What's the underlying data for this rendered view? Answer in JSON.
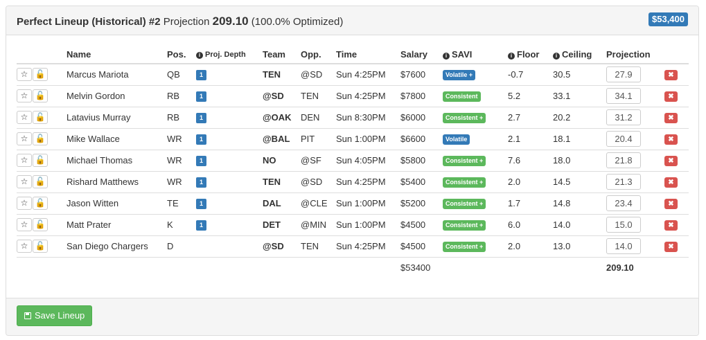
{
  "header": {
    "title_bold": "Perfect Lineup (Historical) #2",
    "projection_label": "Projection",
    "projection_value": "209.10",
    "optimized_text": "(100.0% Optimized)",
    "salary_badge": "$53,400"
  },
  "columns": {
    "name": "Name",
    "pos": "Pos.",
    "depth": "Proj. Depth",
    "team": "Team",
    "opp": "Opp.",
    "time": "Time",
    "salary": "Salary",
    "savi": "SAVI",
    "floor": "Floor",
    "ceiling": "Ceiling",
    "projection": "Projection"
  },
  "colors": {
    "volatile": "#337ab7",
    "consistent": "#5cb85c",
    "remove": "#d9534f",
    "depth": "#337ab7"
  },
  "rows": [
    {
      "name": "Marcus Mariota",
      "pos": "QB",
      "depth": "1",
      "team": "TEN",
      "team_bold": true,
      "opp": "@SD",
      "time": "Sun 4:25PM",
      "salary": "$7600",
      "savi": "Volatile +",
      "savi_type": "volatile",
      "floor": "-0.7",
      "ceiling": "30.5",
      "projection": "27.9"
    },
    {
      "name": "Melvin Gordon",
      "pos": "RB",
      "depth": "1",
      "team": "@SD",
      "team_bold": true,
      "opp": "TEN",
      "time": "Sun 4:25PM",
      "salary": "$7800",
      "savi": "Consistent",
      "savi_type": "consistent",
      "floor": "5.2",
      "ceiling": "33.1",
      "projection": "34.1"
    },
    {
      "name": "Latavius Murray",
      "pos": "RB",
      "depth": "1",
      "team": "@OAK",
      "team_bold": true,
      "opp": "DEN",
      "time": "Sun 8:30PM",
      "salary": "$6000",
      "savi": "Consistent +",
      "savi_type": "consistent",
      "floor": "2.7",
      "ceiling": "20.2",
      "projection": "31.2"
    },
    {
      "name": "Mike Wallace",
      "pos": "WR",
      "depth": "1",
      "team": "@BAL",
      "team_bold": true,
      "opp": "PIT",
      "time": "Sun 1:00PM",
      "salary": "$6600",
      "savi": "Volatile",
      "savi_type": "volatile",
      "floor": "2.1",
      "ceiling": "18.1",
      "projection": "20.4"
    },
    {
      "name": "Michael Thomas",
      "pos": "WR",
      "depth": "1",
      "team": "NO",
      "team_bold": true,
      "opp": "@SF",
      "time": "Sun 4:05PM",
      "salary": "$5800",
      "savi": "Consistent +",
      "savi_type": "consistent",
      "floor": "7.6",
      "ceiling": "18.0",
      "projection": "21.8"
    },
    {
      "name": "Rishard Matthews",
      "pos": "WR",
      "depth": "1",
      "team": "TEN",
      "team_bold": true,
      "opp": "@SD",
      "time": "Sun 4:25PM",
      "salary": "$5400",
      "savi": "Consistent +",
      "savi_type": "consistent",
      "floor": "2.0",
      "ceiling": "14.5",
      "projection": "21.3"
    },
    {
      "name": "Jason Witten",
      "pos": "TE",
      "depth": "1",
      "team": "DAL",
      "team_bold": true,
      "opp": "@CLE",
      "time": "Sun 1:00PM",
      "salary": "$5200",
      "savi": "Consistent +",
      "savi_type": "consistent",
      "floor": "1.7",
      "ceiling": "14.8",
      "projection": "23.4"
    },
    {
      "name": "Matt Prater",
      "pos": "K",
      "depth": "1",
      "team": "DET",
      "team_bold": true,
      "opp": "@MIN",
      "time": "Sun 1:00PM",
      "salary": "$4500",
      "savi": "Consistent +",
      "savi_type": "consistent",
      "floor": "6.0",
      "ceiling": "14.0",
      "projection": "15.0"
    },
    {
      "name": "San Diego Chargers",
      "pos": "D",
      "depth": "",
      "team": "@SD",
      "team_bold": true,
      "opp": "TEN",
      "time": "Sun 4:25PM",
      "salary": "$4500",
      "savi": "Consistent +",
      "savi_type": "consistent",
      "floor": "2.0",
      "ceiling": "13.0",
      "projection": "14.0"
    }
  ],
  "totals": {
    "salary": "$53400",
    "projection": "209.10"
  },
  "footer": {
    "save_label": "Save Lineup"
  }
}
